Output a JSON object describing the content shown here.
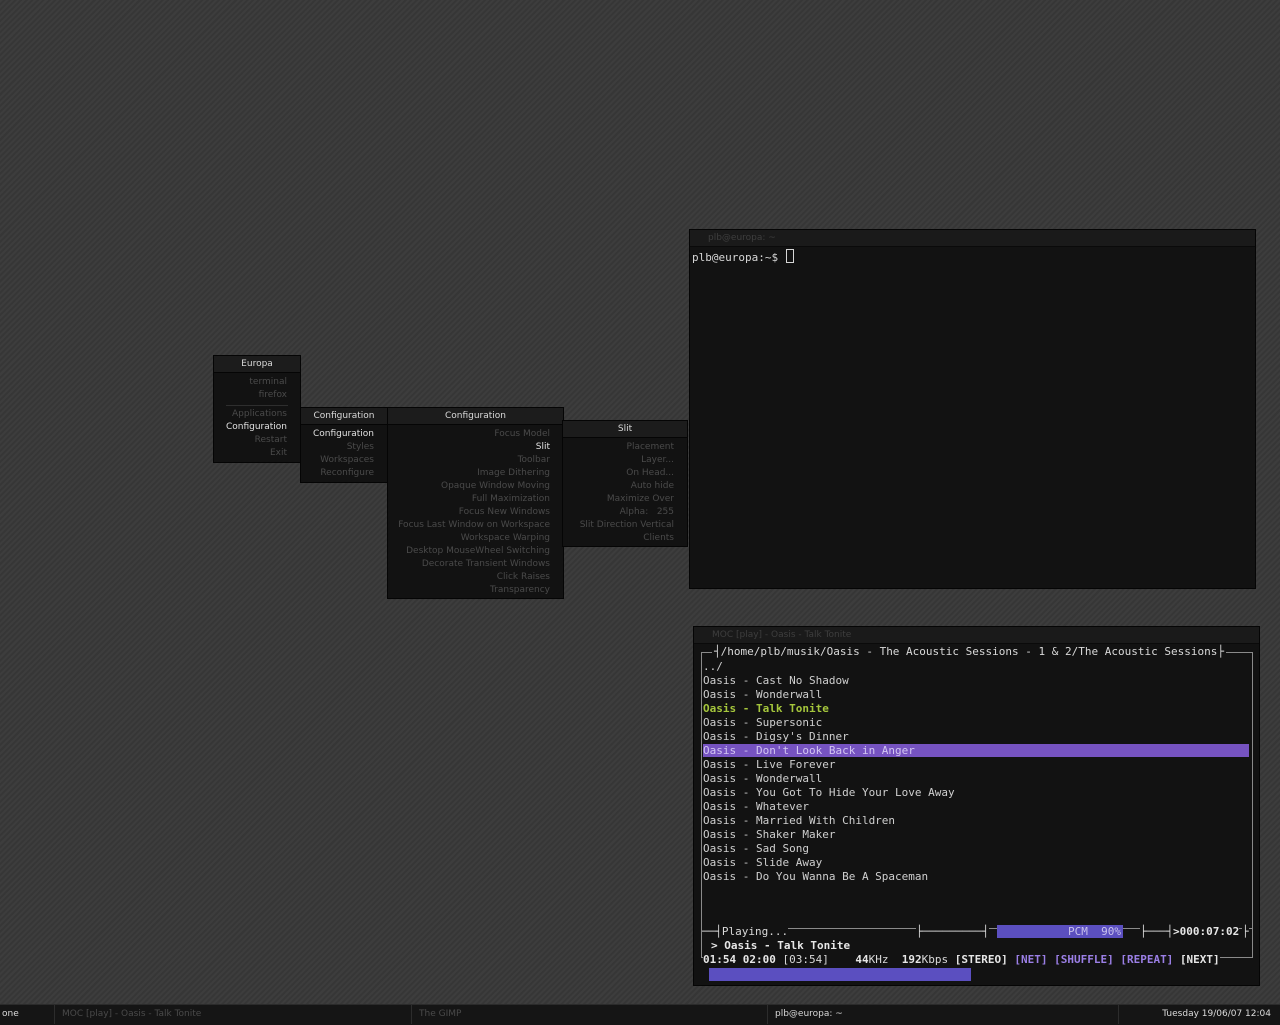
{
  "root_menu": {
    "title": "Europa",
    "items": [
      {
        "label": "terminal",
        "selected": false
      },
      {
        "label": "firefox",
        "selected": false
      },
      {
        "label": "Applications",
        "selected": false
      },
      {
        "label": "Configuration",
        "selected": true
      },
      {
        "label": "Restart",
        "selected": false
      },
      {
        "label": "Exit",
        "selected": false
      }
    ]
  },
  "config_menu": {
    "title": "Configuration",
    "items": [
      {
        "label": "Configuration",
        "selected": true
      },
      {
        "label": "Styles",
        "selected": false
      },
      {
        "label": "Workspaces",
        "selected": false
      },
      {
        "label": "Reconfigure",
        "selected": false
      }
    ]
  },
  "config_submenu": {
    "title": "Configuration",
    "items": [
      {
        "label": "Focus Model",
        "selected": false
      },
      {
        "label": "Slit",
        "selected": true
      },
      {
        "label": "Toolbar",
        "selected": false
      },
      {
        "label": "Image Dithering",
        "selected": false
      },
      {
        "label": "Opaque Window Moving",
        "selected": false
      },
      {
        "label": "Full Maximization",
        "selected": false
      },
      {
        "label": "Focus New Windows",
        "selected": false
      },
      {
        "label": "Focus Last Window on Workspace",
        "selected": false
      },
      {
        "label": "Workspace Warping",
        "selected": false
      },
      {
        "label": "Desktop MouseWheel Switching",
        "selected": false
      },
      {
        "label": "Decorate Transient Windows",
        "selected": false
      },
      {
        "label": "Click Raises",
        "selected": false
      },
      {
        "label": "Transparency",
        "selected": false
      }
    ]
  },
  "slit_menu": {
    "title": "Slit",
    "items": [
      {
        "label": "Placement",
        "selected": false
      },
      {
        "label": "Layer...",
        "selected": false
      },
      {
        "label": "On Head...",
        "selected": false
      },
      {
        "label": "Auto hide",
        "selected": false
      },
      {
        "label": "Maximize Over",
        "selected": false
      },
      {
        "label": "Alpha:   255",
        "selected": false
      },
      {
        "label": "Slit Direction Vertical",
        "selected": false
      },
      {
        "label": "Clients",
        "selected": false
      }
    ]
  },
  "terminal": {
    "title": "plb@europa: ~",
    "prompt": "plb@europa:~$ "
  },
  "moc": {
    "title": "MOC [play] - Oasis - Talk Tonite",
    "path": "/home/plb/musik/Oasis - The Acoustic Sessions - 1 & 2/The Acoustic Sessions",
    "tracks": [
      {
        "label": "../",
        "state": "normal"
      },
      {
        "label": "Oasis - Cast No Shadow",
        "state": "normal"
      },
      {
        "label": "Oasis - Wonderwall",
        "state": "normal"
      },
      {
        "label": "Oasis - Talk Tonite",
        "state": "playing"
      },
      {
        "label": "Oasis - Supersonic",
        "state": "normal"
      },
      {
        "label": "Oasis - Digsy's Dinner",
        "state": "normal"
      },
      {
        "label": "Oasis - Don't Look Back in Anger",
        "state": "current"
      },
      {
        "label": "Oasis - Live Forever",
        "state": "normal"
      },
      {
        "label": "Oasis - Wonderwall",
        "state": "normal"
      },
      {
        "label": "Oasis - You Got To Hide Your Love Away",
        "state": "normal"
      },
      {
        "label": "Oasis - Whatever",
        "state": "normal"
      },
      {
        "label": "Oasis - Married With Children",
        "state": "normal"
      },
      {
        "label": "Oasis - Shaker Maker",
        "state": "normal"
      },
      {
        "label": "Oasis - Sad Song",
        "state": "normal"
      },
      {
        "label": "Oasis - Slide Away",
        "state": "normal"
      },
      {
        "label": "Oasis - Do You Wanna Be A Spaceman",
        "state": "normal"
      }
    ],
    "status": "Playing...",
    "mixer_label": "PCM",
    "mixer_value": "90%",
    "total_time": ">000:07:02",
    "now_playing": "> Oasis - Talk Tonite",
    "elapsed": "01:54",
    "remaining": "02:00",
    "duration": "[03:54]",
    "rate": "44",
    "rate_unit": "KHz",
    "bitrate": "192",
    "bitrate_unit": "Kbps",
    "tags": [
      {
        "label": "[STEREO]",
        "active": true
      },
      {
        "label": "[NET]",
        "active": false
      },
      {
        "label": "[SHUFFLE]",
        "active": false
      },
      {
        "label": "[REPEAT]",
        "active": false
      },
      {
        "label": "[NEXT]",
        "active": true
      }
    ],
    "progress": 0.49,
    "colors": {
      "accent": "#7653c1",
      "playing": "#a5c63c",
      "bar": "#5b4fc0"
    }
  },
  "taskbar": {
    "workspace": "one",
    "tasks": [
      {
        "label": "MOC [play] - Oasis - Talk Tonite",
        "active": false
      },
      {
        "label": "The GIMP",
        "active": false
      },
      {
        "label": "plb@europa: ~",
        "active": true
      }
    ],
    "clock": "Tuesday 19/06/07 12:04"
  }
}
